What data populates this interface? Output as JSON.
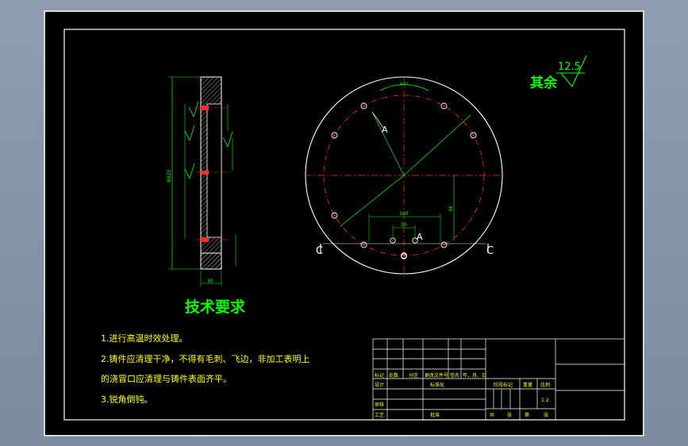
{
  "roughness": {
    "label": "其余",
    "value": "12.5"
  },
  "requirements": {
    "title": "技术要求",
    "lines": [
      "1.进行高温时效处理。",
      "2.铸件应清理干净，不得有毛刺、飞边，非加工表明上",
      "的浇冒口应清理与铸件表面齐平。",
      "3.锐角倒钝。"
    ]
  },
  "section_labels": {
    "left": "C",
    "right": "C",
    "a_upper": "A",
    "a_lower": "A"
  },
  "dimensions": {
    "bolt_spacing": "100",
    "inner_spacing": "30",
    "vertical_offset": "36",
    "angle": "60°",
    "side_thickness": "30",
    "side_height": "Φ820"
  },
  "title_block": {
    "header_cells": [
      "标记",
      "处数",
      "分区",
      "更改文件号",
      "签名",
      "年、月、日"
    ],
    "row_design": [
      "设计",
      "标准化"
    ],
    "row_check": [
      "审核"
    ],
    "row_process": [
      "工艺",
      "批准"
    ],
    "stage_cells": [
      "阶段标记",
      "重量",
      "比例"
    ],
    "scale": "1:2",
    "sheet_cells": [
      "共",
      "张",
      "第",
      "张"
    ]
  },
  "colors": {
    "background": "#000000",
    "frame": "#ffffff",
    "outline": "#ffffff",
    "dimension": "#00ff00",
    "center_line": "#ff2a2a",
    "text": "#ffff00"
  }
}
